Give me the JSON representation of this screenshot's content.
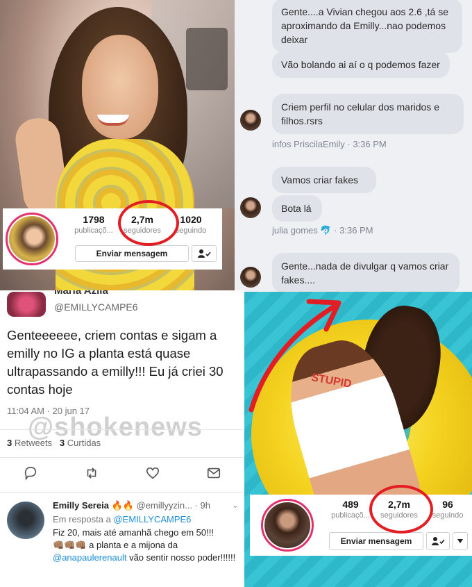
{
  "profile_top": {
    "stats": [
      {
        "number": "1798",
        "label": "publicaçõ..."
      },
      {
        "number": "2,7m",
        "label": "seguidores"
      },
      {
        "number": "1020",
        "label": "seguindo"
      }
    ],
    "message_button": "Enviar mensagem"
  },
  "chat": {
    "messages": [
      {
        "text": "Gente....a Vivian chegou aos 2.6 ,tá se aproximando da Emilly...nao podemos deixar"
      },
      {
        "text": "Vão bolando ai aí o q podemos fazer"
      },
      {
        "text": "Criem perfil no celular dos maridos e filhos.rsrs"
      },
      {
        "text": "Vamos criar fakes"
      },
      {
        "text": "Bota lá"
      },
      {
        "text": "Gente...nada de divulgar q vamos criar fakes...."
      }
    ],
    "meta1": {
      "name": "infos PriscilaEmily",
      "time": "· 3:36 PM"
    },
    "meta2": {
      "name": "julia gomes",
      "emoji": "🐬",
      "time": "· 3:36 PM"
    }
  },
  "tweet": {
    "name_cut": "Maria Azila",
    "handle": "@EMILLYCAMPE6",
    "body": "Genteeeeee, criem contas e sigam a emilly no IG a planta está quase ultrapassando  a emilly!!! Eu já criei 30 contas hoje",
    "time": "11:04 AM · 20 jun 17",
    "retweets_count": "3",
    "retweets_label": "Retweets",
    "likes_count": "3",
    "likes_label": "Curtidas",
    "watermark": "@shokenews"
  },
  "reply": {
    "name": "Emilly Sereia 🔥🔥",
    "handle": "@emillyyzin...",
    "age": "· 9h",
    "in_reply_prefix": "Em resposta a",
    "in_reply_handle": "@EMILLYCAMPE6",
    "line1": "Fiz 20, mais até amanhã chego em 50!!!",
    "line2_emoji": "👊🏽👊🏽👊🏽",
    "line2": " a planta e a mijona da",
    "mention": "@anapaulerenault",
    "line3": " vão sentir nosso poder!!!!!!"
  },
  "profile_bottom": {
    "stats": [
      {
        "number": "489",
        "label": "publicaçõ..."
      },
      {
        "number": "2,7m",
        "label": "seguidores"
      },
      {
        "number": "96",
        "label": "seguindo"
      }
    ],
    "message_button": "Enviar mensagem"
  },
  "photo_br": {
    "swimsuit_text": "STUPID"
  },
  "colors": {
    "highlight_red": "#e21d24",
    "twitter_blue": "#1d8fd8",
    "chat_bubble": "#dfe2e8"
  }
}
